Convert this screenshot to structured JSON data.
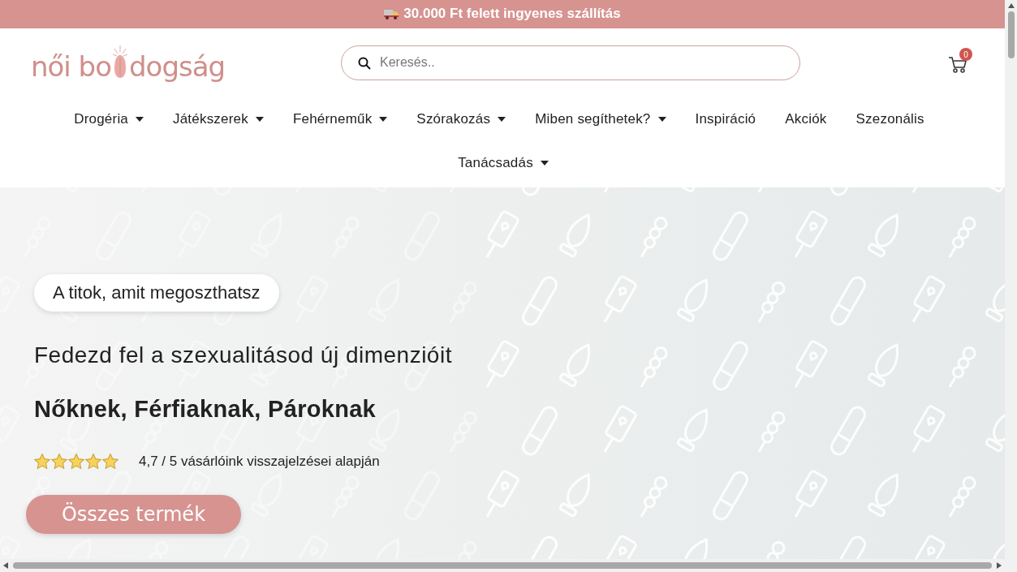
{
  "announcement": {
    "text": "30.000 Ft felett ingyenes szállítás"
  },
  "logo": {
    "before": "női bo",
    "after": "dogság"
  },
  "search": {
    "placeholder": "Keresés.."
  },
  "cart": {
    "count": "0"
  },
  "nav": [
    {
      "label": "Drogéria",
      "has_submenu": true
    },
    {
      "label": "Játékszerek",
      "has_submenu": true
    },
    {
      "label": "Fehérneműk",
      "has_submenu": true
    },
    {
      "label": "Szórakozás",
      "has_submenu": true
    },
    {
      "label": "Miben segíthetek?",
      "has_submenu": true
    },
    {
      "label": "Inspiráció",
      "has_submenu": false
    },
    {
      "label": "Akciók",
      "has_submenu": false
    },
    {
      "label": "Szezonális",
      "has_submenu": false
    },
    {
      "label": "Tanácsadás",
      "has_submenu": true
    }
  ],
  "hero": {
    "tagline": "A titok, amit megoszthatsz",
    "headline": "Fedezd fel a szexualitásod új dimenzióit",
    "subheadline": "Nőknek, Férfiaknak, Pároknak",
    "rating": {
      "stars": 5,
      "text": "4,7 / 5 vásárlóink visszajelzései alapján"
    },
    "button": "Összes termék"
  }
}
